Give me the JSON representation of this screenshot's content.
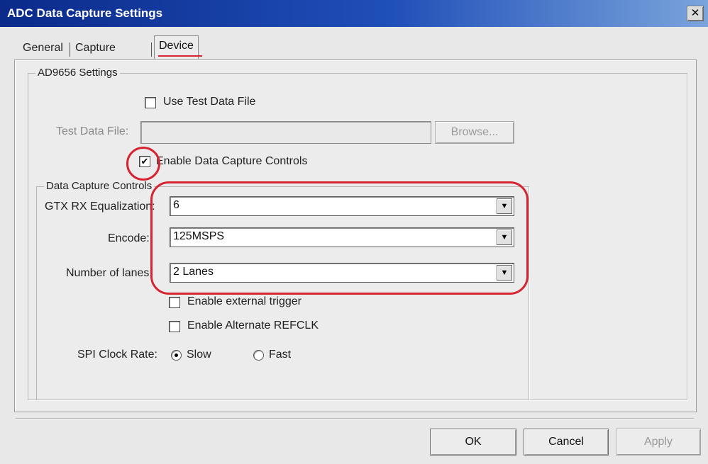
{
  "window": {
    "title": "ADC Data Capture Settings",
    "close_label": "✕"
  },
  "tabs": [
    {
      "label": "General"
    },
    {
      "label": "Capture Board"
    },
    {
      "label": "Device"
    }
  ],
  "active_tab": "Device",
  "settings_group": {
    "title": "AD9656 Settings"
  },
  "use_test_data_file": {
    "label": "Use Test Data File",
    "checked": false
  },
  "test_data_file": {
    "label": "Test Data File:",
    "value": "",
    "browse_label": "Browse..."
  },
  "enable_data_capture_controls": {
    "label": "Enable Data Capture Controls",
    "checked": true,
    "check_mark": "✔"
  },
  "data_capture_group": {
    "title": "Data Capture Controls"
  },
  "gtx_rx_equalization": {
    "label": "GTX RX Equalization:",
    "value": "6"
  },
  "encode": {
    "label": "Encode:",
    "value": "125MSPS"
  },
  "number_of_lanes": {
    "label": "Number of lanes:",
    "value": "2 Lanes"
  },
  "enable_external_trigger": {
    "label": "Enable external trigger",
    "checked": false
  },
  "enable_alternate_refclk": {
    "label": "Enable Alternate REFCLK",
    "checked": false
  },
  "spi_clock_rate": {
    "label": "SPI Clock Rate:",
    "options": [
      {
        "label": "Slow",
        "selected": true
      },
      {
        "label": "Fast",
        "selected": false
      }
    ]
  },
  "footer": {
    "ok_label": "OK",
    "cancel_label": "Cancel",
    "apply_label": "Apply"
  },
  "colors": {
    "annotation": "#d62430",
    "titlebar_start": "#0b2a8a",
    "titlebar_end": "#7aa4dc"
  },
  "icons": {
    "dropdown": "chevron-down-icon",
    "close": "close-icon"
  }
}
